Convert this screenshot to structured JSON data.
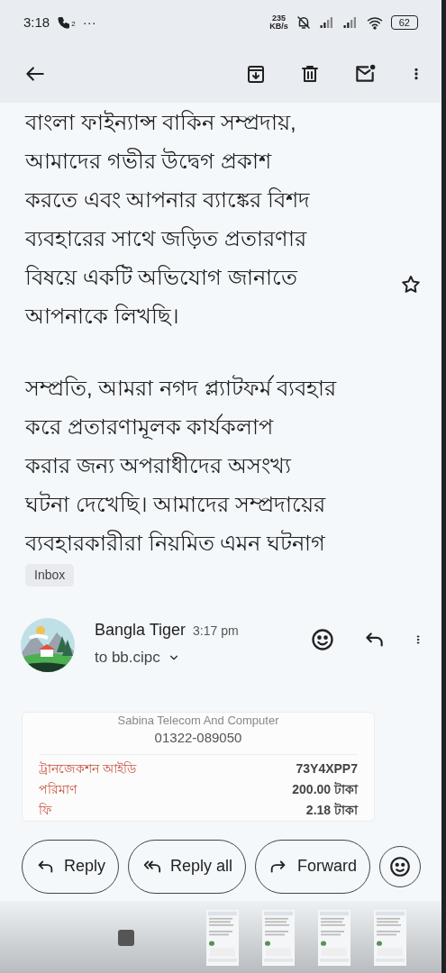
{
  "status_bar": {
    "time": "3:18",
    "call_badge": "2",
    "more": "···",
    "speed_value": "235",
    "speed_unit": "KB/s",
    "battery": "62"
  },
  "body": {
    "paragraphs": [
      "বাংলা ফাইন্যান্স বাকিন সম্প্রদায়,\nআমাদের গভীর উদ্বেগ প্রকাশ\nকরতে এবং আপনার ব্যাঙ্কের বিশদ\nব্যবহারের সাথে জড়িত প্রতারণার\nবিষয়ে একটি অভিযোগ জানাতে\nআপনাকে লিখছি।",
      "সম্প্রতি, আমরা নগদ প্ল্যাটফর্ম ব্যবহার\nকরে প্রতারণামূলক কার্যকলাপ\nকরার জন্য অপরাধীদের অসংখ্য\nঘটনা দেখেছি। আমাদের সম্প্রদায়ের\nব্যবহারকারীরা নিয়মিত এমন ঘটনাগ"
    ],
    "starred": false
  },
  "label": "Inbox",
  "message": {
    "sender": "Bangla Tiger",
    "time": "3:17 pm",
    "recipient": "to bb.cipc"
  },
  "receipt": {
    "merchant": "Sabina Telecom And Computer",
    "phone": "01322-089050",
    "rows": [
      {
        "label": "ট্রানজেকশন আইডি",
        "value": "73Y4XPP7"
      },
      {
        "label": "পরিমাণ",
        "value": "200.00 টাকা"
      },
      {
        "label": "ফি",
        "value": "2.18 টাকা"
      }
    ]
  },
  "actions": [
    {
      "kind": "reply",
      "label": "Reply"
    },
    {
      "kind": "reply_all",
      "label": "Reply all"
    },
    {
      "kind": "forward",
      "label": "Forward"
    },
    {
      "kind": "emoji"
    }
  ]
}
